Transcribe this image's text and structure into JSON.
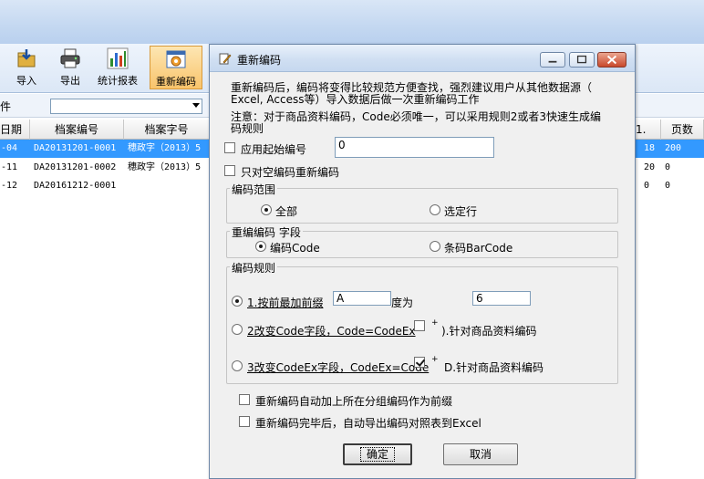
{
  "toolbar": {
    "buttons": [
      {
        "label": "导入"
      },
      {
        "label": "导出"
      },
      {
        "label": "统计报表"
      },
      {
        "label": "重新编码"
      }
    ]
  },
  "filter": {
    "label_fragment": "件"
  },
  "grid": {
    "columns": [
      "日期",
      "档案编号",
      "档案字号",
      "页数"
    ],
    "col_fragment": "1.",
    "rows": [
      {
        "date": "-04",
        "code": "DA20131201-0001",
        "ref": "穗政字（2013）5",
        "n": "18",
        "pages": "200",
        "selected": true
      },
      {
        "date": "-11",
        "code": "DA20131201-0002",
        "ref": "穗政字（2013）5",
        "n": "20",
        "pages": "0",
        "selected": false
      },
      {
        "date": "-12",
        "code": "DA20161212-0001",
        "ref": "",
        "n": "0",
        "pages": "0",
        "selected": false
      }
    ]
  },
  "dialog": {
    "title": "重新编码",
    "desc_line1": "重新编码后，编码将变得比较规范方便查找，强烈建议用户从其他数据源（",
    "desc_line2": "Excel, Access等）导入数据后做一次重新编码工作",
    "note_line1": "注意：对于商品资料编码，Code必须唯一，可以采用规则2或者3快速生成编",
    "note_line2": "码规则",
    "apply_start_label": "应用起始编号",
    "apply_start_value": "0",
    "empty_only_label": "只对空编码重新编码",
    "range_group": "编码范围",
    "range_all": "全部",
    "range_selected": "选定行",
    "field_group": "重编编码 字段",
    "field_code": "编码Code",
    "field_barcode": "条码BarCode",
    "rule_group": "编码规则",
    "rule1_label": "1.按前最加前缀",
    "rule1_prefix": "A",
    "rule1_len_label": "度为",
    "rule1_len_value": "6",
    "rule2_label": "2改变Code字段，Code=CodeEx",
    "rule2_check_mark": "+",
    "rule2_check_label": ").针对商品资料编码",
    "rule3_label": "3改变CodeEx字段，CodeEx=Code",
    "rule3_check_mark": "+",
    "rule3_check_label": "D.针对商品资料编码",
    "auto_prefix_label": "重新编码自动加上所在分组编码作为前缀",
    "export_label": "重新编码完毕后，自动导出编码对照表到Excel",
    "ok": "确定",
    "cancel": "取消"
  }
}
